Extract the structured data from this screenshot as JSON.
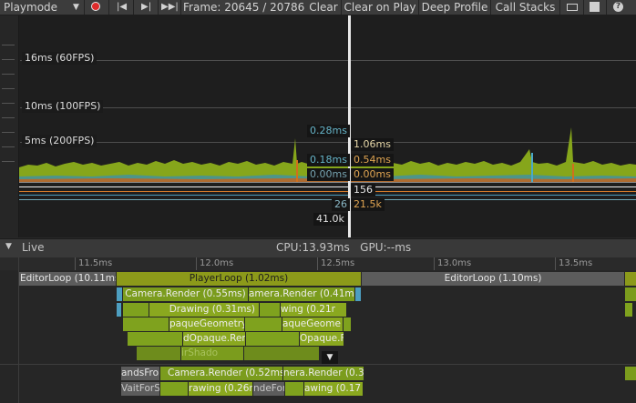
{
  "toolbar": {
    "mode": "Playmode",
    "frame_text": "Frame: 20645 / 20786",
    "clear": "Clear",
    "clear_on_play": "Clear on Play",
    "deep_profile": "Deep Profile",
    "call_stacks": "Call Stacks"
  },
  "chart": {
    "grid": [
      {
        "label": "16ms (60FPS)"
      },
      {
        "label": "10ms (100FPS)"
      },
      {
        "label": "5ms (200FPS)"
      }
    ],
    "tooltips_left": [
      "0.28ms",
      "0.18ms",
      "0.00ms",
      "26",
      "41.0k"
    ],
    "tooltips_right": [
      "1.06ms",
      "0.54ms",
      "0.00ms",
      "156",
      "21.5k"
    ]
  },
  "live": {
    "label": "Live",
    "stats": "CPU:13.93ms   GPU:--ms"
  },
  "timeline": {
    "ticks": [
      "11.5ms",
      "12.0ms",
      "12.5ms",
      "13.0ms",
      "13.5ms"
    ],
    "row1": {
      "editor_left": "EditorLoop (10.11ms)",
      "player": "PlayerLoop (1.02ms)",
      "editor_right": "EditorLoop (1.10ms)"
    },
    "row2": {
      "a": "Camera.Render (0.55ms)",
      "b": "amera.Render (0.41m"
    },
    "row3": {
      "a": "Drawing (0.31ms)",
      "b": "wing (0.21r"
    },
    "row4": {
      "a": "paqueGeometry",
      "b": "aqueGeome"
    },
    "row5": {
      "a": "dOpaque.Rer",
      "b": "Opaque.F"
    },
    "row6": {
      "a": "irShado"
    },
    "lower1": {
      "a": "andsFron",
      "b": "Camera.Render (0.52ms)",
      "c": "nera.Render (0.33"
    },
    "lower2": {
      "a": "VaitForSi",
      "b": "rawing (0.26m",
      "c": "ndeFor",
      "d": "awing (0.17"
    }
  },
  "colors": {
    "accent_green": "#8fb01c",
    "player_loop": "#8c9a1a",
    "editor_loop": "#5e5e5e",
    "camera_render": "#7b9c1d",
    "cursor": "#e0e0e0"
  }
}
